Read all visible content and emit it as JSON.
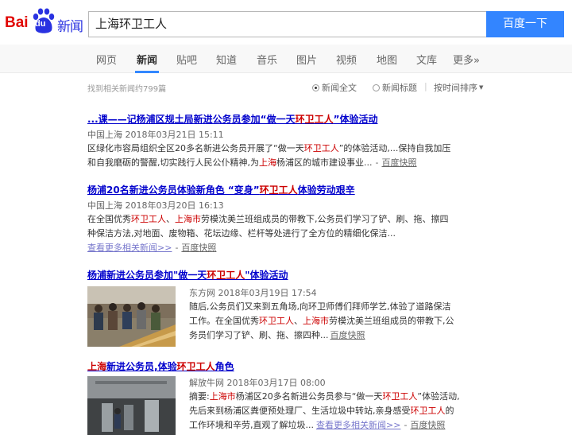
{
  "logo": {
    "bai": "Bai",
    "du": "du",
    "news": "新闻"
  },
  "search": {
    "query": "上海环卫工人",
    "button_label": "百度一下"
  },
  "nav": {
    "items": [
      {
        "label": "网页"
      },
      {
        "label": "新闻"
      },
      {
        "label": "贴吧"
      },
      {
        "label": "知道"
      },
      {
        "label": "音乐"
      },
      {
        "label": "图片"
      },
      {
        "label": "视频"
      },
      {
        "label": "地图"
      },
      {
        "label": "文库"
      },
      {
        "label": "更多»"
      }
    ],
    "active": "新闻"
  },
  "toolbar": {
    "result_count": "找到相关新闻约799篇",
    "opt_fulltext": "新闻全文",
    "opt_title": "新闻标题",
    "separator": "|",
    "sort_label": "按时间排序",
    "selected": "新闻全文"
  },
  "results": [
    {
      "title_pre": "...课——记杨浦区规土局新进公务员参加“做一天",
      "title_hl": "环卫工人",
      "title_post": "”体验活动",
      "meta": "中国上海  2018年03月21日 15:11",
      "abs_1_pre": "区绿化市容局组织全区20多名新进公务员开展了“做一天",
      "abs_1_hl": "环卫工人",
      "abs_1_post": "”的体验活动,...保持自我加压",
      "abs_2_pre": "和自我磨砺的警醒,切实践行人民公仆精神,为",
      "abs_2_hl": "上海",
      "abs_2_post": "杨浦区的城市建设事业...",
      "snapshot": "百度快照"
    },
    {
      "title_pre": "杨浦20名新进公务员体验新角色 “变身”",
      "title_hl": "环卫工人",
      "title_post": "体验劳动艰辛",
      "meta": "中国上海  2018年03月20日 16:13",
      "abs_1_a": "在全国优秀",
      "abs_1_hl1": "环卫工人",
      "abs_1_b": "、",
      "abs_1_hl2": "上海市",
      "abs_1_c": "劳模沈美兰班组成员的带教下,公务员们学习了铲、刷、拖、擦四",
      "abs_2": "种保洁方法,对地面、废物箱、花坛边缘、栏杆等处进行了全方位的精细化保洁...",
      "more": "查看更多相关新闻>>",
      "snapshot": "百度快照"
    },
    {
      "title_pre": "杨浦新进公务员参加\"做一天",
      "title_hl": "环卫工人",
      "title_post": "\"体验活动",
      "meta": "东方网  2018年03月19日 17:54",
      "abs_1": "随后,公务员们又来到五角场,向环卫师傅们拜师学艺,体验了道路保洁",
      "abs_2_a": "工作。在全国优秀",
      "abs_2_hl1": "环卫工人",
      "abs_2_b": "、",
      "abs_2_hl2": "上海市",
      "abs_2_c": "劳模沈美兰班组成员的带教下,公",
      "abs_3": "务员们学习了铲、刷、拖、擦四种...",
      "snapshot": "百度快照"
    },
    {
      "title_hl1": "上海",
      "title_mid": "新进公务员,体验",
      "title_hl2": "环卫工人",
      "title_post": "角色",
      "meta": "解放牛网  2018年03月17日 08:00",
      "abs_1_a": "摘要:",
      "abs_1_hl1": "上海市",
      "abs_1_b": "杨浦区20多名新进公务员参与“做一天",
      "abs_1_hl2": "环卫工人",
      "abs_1_c": "”体验活动,",
      "abs_2_a": "先后来到杨浦区粪便预处理厂、生活垃圾中转站,亲身感受",
      "abs_2_hl": "环卫工人",
      "abs_2_b": "的",
      "abs_3": "工作环境和辛劳,直观了解垃圾...",
      "more": "查看更多相关新闻>>",
      "snapshot": "百度快照"
    }
  ],
  "colors": {
    "accent": "#3385ff",
    "title_link": "#0000cc",
    "highlight": "#cc0000",
    "logo_red": "#e10602",
    "logo_blue": "#2932e1"
  }
}
